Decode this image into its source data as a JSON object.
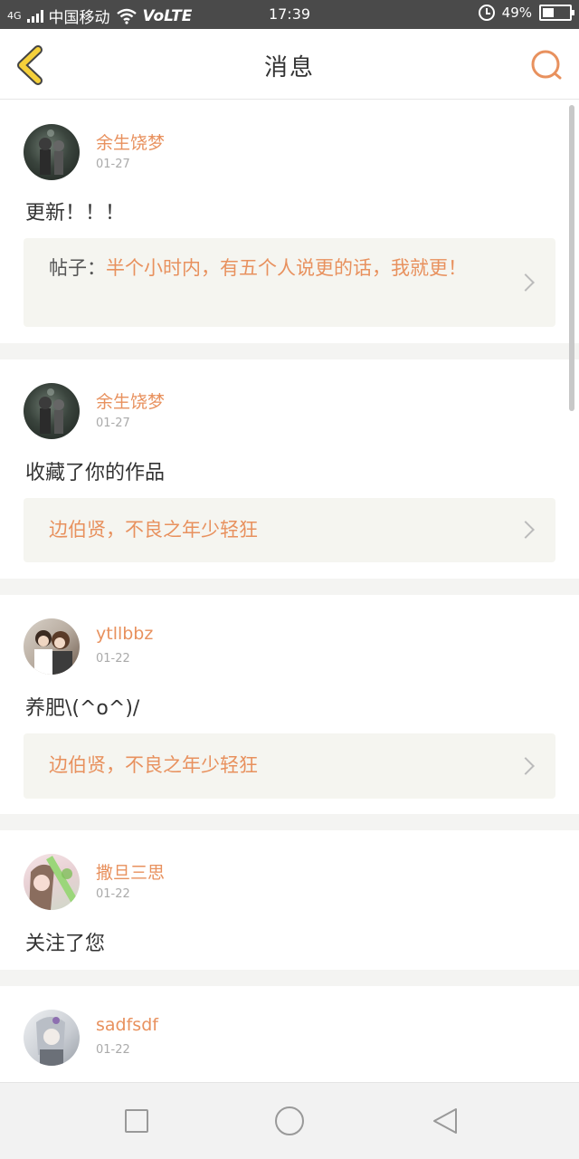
{
  "status_bar": {
    "network": "4G",
    "carrier": "中国移动",
    "volte": "VoLTE",
    "time": "17:39",
    "battery": "49%",
    "battery_level": 0.49
  },
  "header": {
    "title": "消息"
  },
  "messages": [
    {
      "user": "余生饶梦",
      "date": "01-27",
      "text": "更新！！！",
      "quote_prefix": "帖子：",
      "quote": "半个小时内，有五个人说更的话，我就更！"
    },
    {
      "user": "余生饶梦",
      "date": "01-27",
      "text": "收藏了你的作品",
      "quote": "边伯贤，不良之年少轻狂"
    },
    {
      "user": "ytllbbz",
      "date": "01-22",
      "text": "养肥\\(^o^)/",
      "quote": "边伯贤，不良之年少轻狂"
    },
    {
      "user": "撒旦三思",
      "date": "01-22",
      "text": "关注了您"
    },
    {
      "user": "sadfsdf",
      "date": "01-22"
    }
  ],
  "colors": {
    "accent": "#e8915e",
    "back_arrow": "#f5d03a",
    "quote_bg": "#f5f5f0"
  }
}
